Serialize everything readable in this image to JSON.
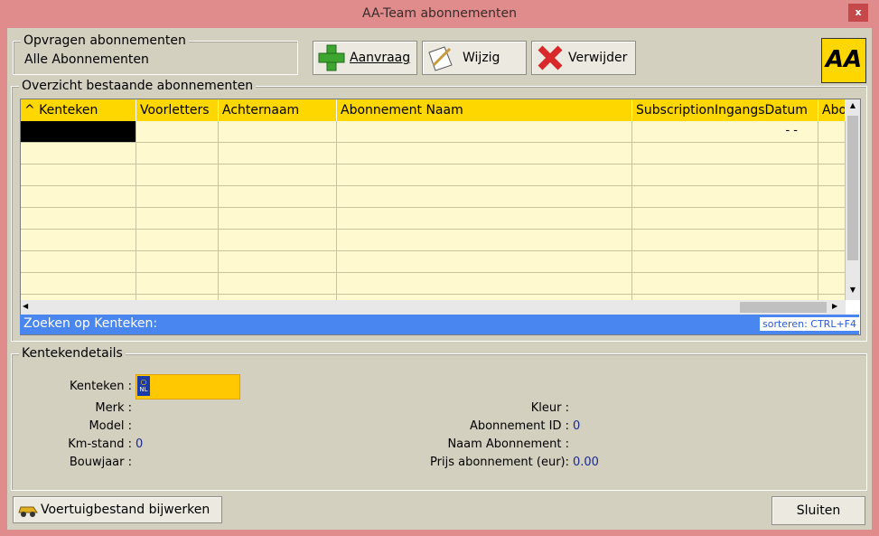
{
  "window": {
    "title": "AA-Team abonnementen",
    "close_label": "x"
  },
  "query": {
    "legend": "Opvragen abonnementen",
    "value": "Alle Abonnementen"
  },
  "toolbar": {
    "add_label": "Aanvraag",
    "edit_label": "Wijzig",
    "delete_label": "Verwijder"
  },
  "logo": {
    "text": "AA"
  },
  "overview": {
    "legend": "Overzicht bestaande abonnementen",
    "columns": [
      "^ Kenteken",
      "Voorletters",
      "Achternaam",
      "Abonnement Naam",
      "SubscriptionIngangsDatum",
      "Abo"
    ],
    "first_row_date": "-  -",
    "search_label": "Zoeken op Kenteken:",
    "sort_hint": "sorteren: CTRL+F4"
  },
  "details": {
    "legend": "Kentekendetails",
    "kenteken_label": "Kenteken :",
    "plate_country": "NL",
    "merk_label": "Merk :",
    "model_label": "Model :",
    "kmstand_label": "Km-stand :",
    "kmstand_value": "0",
    "bouwjaar_label": "Bouwjaar :",
    "kleur_label": "Kleur :",
    "abonnement_id_label": "Abonnement ID :",
    "abonnement_id_value": "0",
    "naam_label": "Naam Abonnement :",
    "prijs_label": "Prijs abonnement (eur):",
    "prijs_value": "0.00"
  },
  "footer": {
    "update_label": "Voertuigbestand bijwerken",
    "close_label": "Sluiten"
  },
  "colors": {
    "accent_yellow": "#ffd700",
    "search_blue": "#4a86f0",
    "window_border": "#e08c8c"
  }
}
